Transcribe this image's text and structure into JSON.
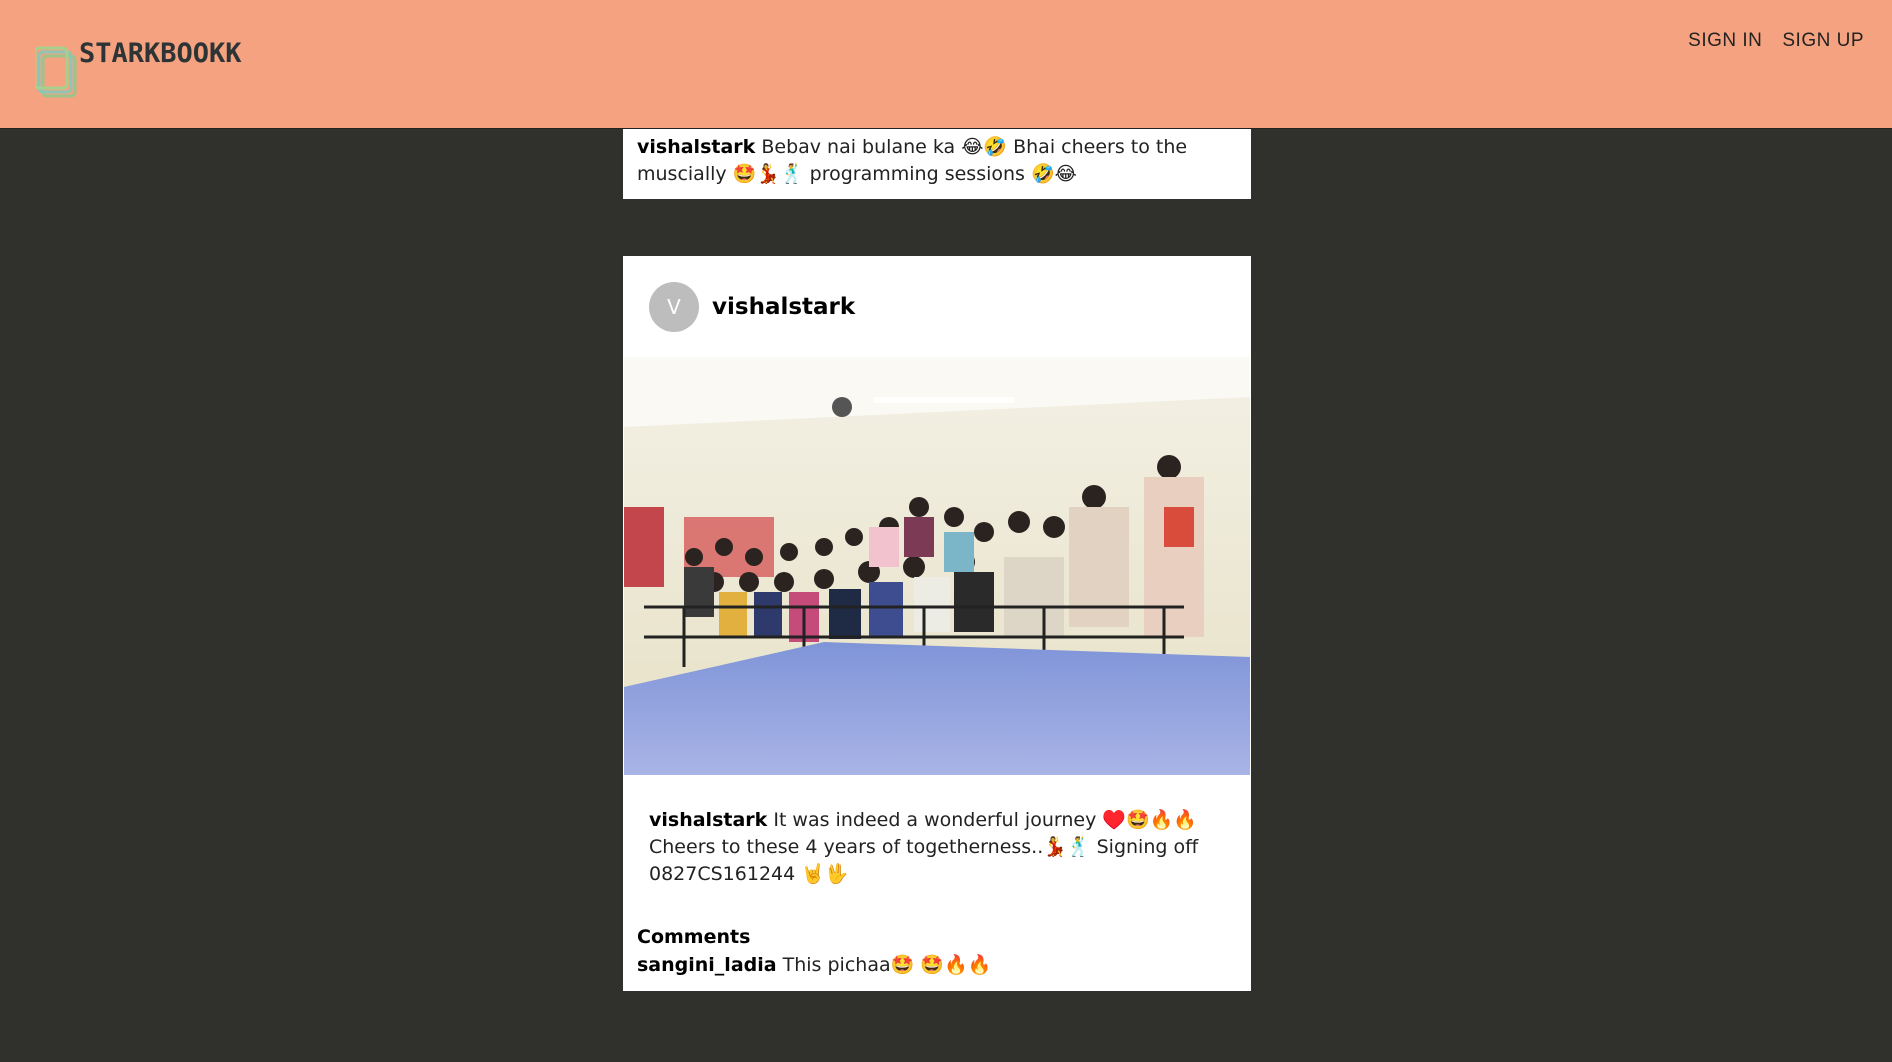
{
  "header": {
    "logo_text": "STARKBOOKK",
    "nav": {
      "sign_in": "SIGN IN",
      "sign_up": "SIGN UP"
    }
  },
  "colors": {
    "header_bg": "#f4a27f",
    "page_bg": "#30302c",
    "card_bg": "#ffffff"
  },
  "posts": [
    {
      "caption_user": "vishalstark",
      "caption_text": "Bebav nai bulane ka 😂🤣 Bhai cheers to the muscially 🤩💃🕺 programming sessions 🤣😂"
    },
    {
      "avatar_letter": "V",
      "username": "vishalstark",
      "image_icon": "group-photo-classroom",
      "caption_user": "vishalstark",
      "caption_text": "It was indeed a wonderful journey ♥️🤩🔥🔥 Cheers to these 4 years of togetherness..💃🕺 Signing off 0827CS161244 🤘🖖",
      "comments_title": "Comments",
      "comments": [
        {
          "user": "sangini_ladia",
          "text": "This pichaa🤩 🤩🔥🔥"
        }
      ]
    }
  ]
}
